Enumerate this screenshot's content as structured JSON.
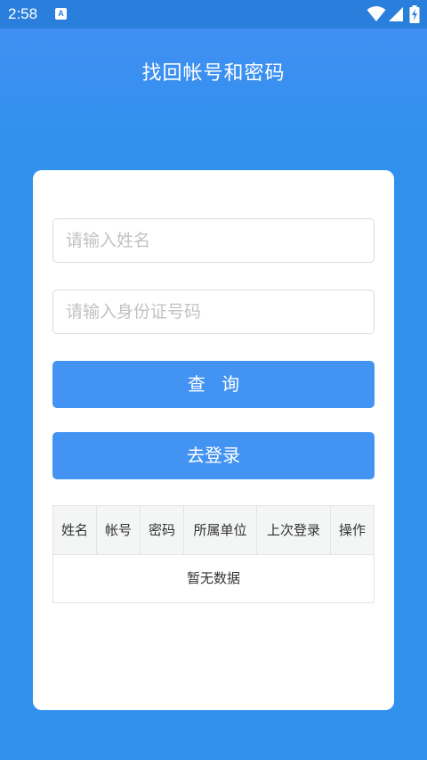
{
  "status_bar": {
    "time": "2:58",
    "notification_glyph": "A",
    "icons": [
      "wifi-icon",
      "cell-signal-icon",
      "battery-charging-icon"
    ]
  },
  "header": {
    "title": "找回帐号和密码"
  },
  "form": {
    "name_placeholder": "请输入姓名",
    "id_placeholder": "请输入身份证号码",
    "query_label": "查 询",
    "login_label": "去登录"
  },
  "table": {
    "columns": [
      "姓名",
      "帐号",
      "密码",
      "所属单位",
      "上次登录",
      "操作"
    ],
    "rows": [],
    "empty_text": "暂无数据"
  },
  "colors": {
    "background": "#3391ee",
    "status_bar": "#2a7fdc",
    "button": "#4393f3",
    "card": "#ffffff"
  }
}
